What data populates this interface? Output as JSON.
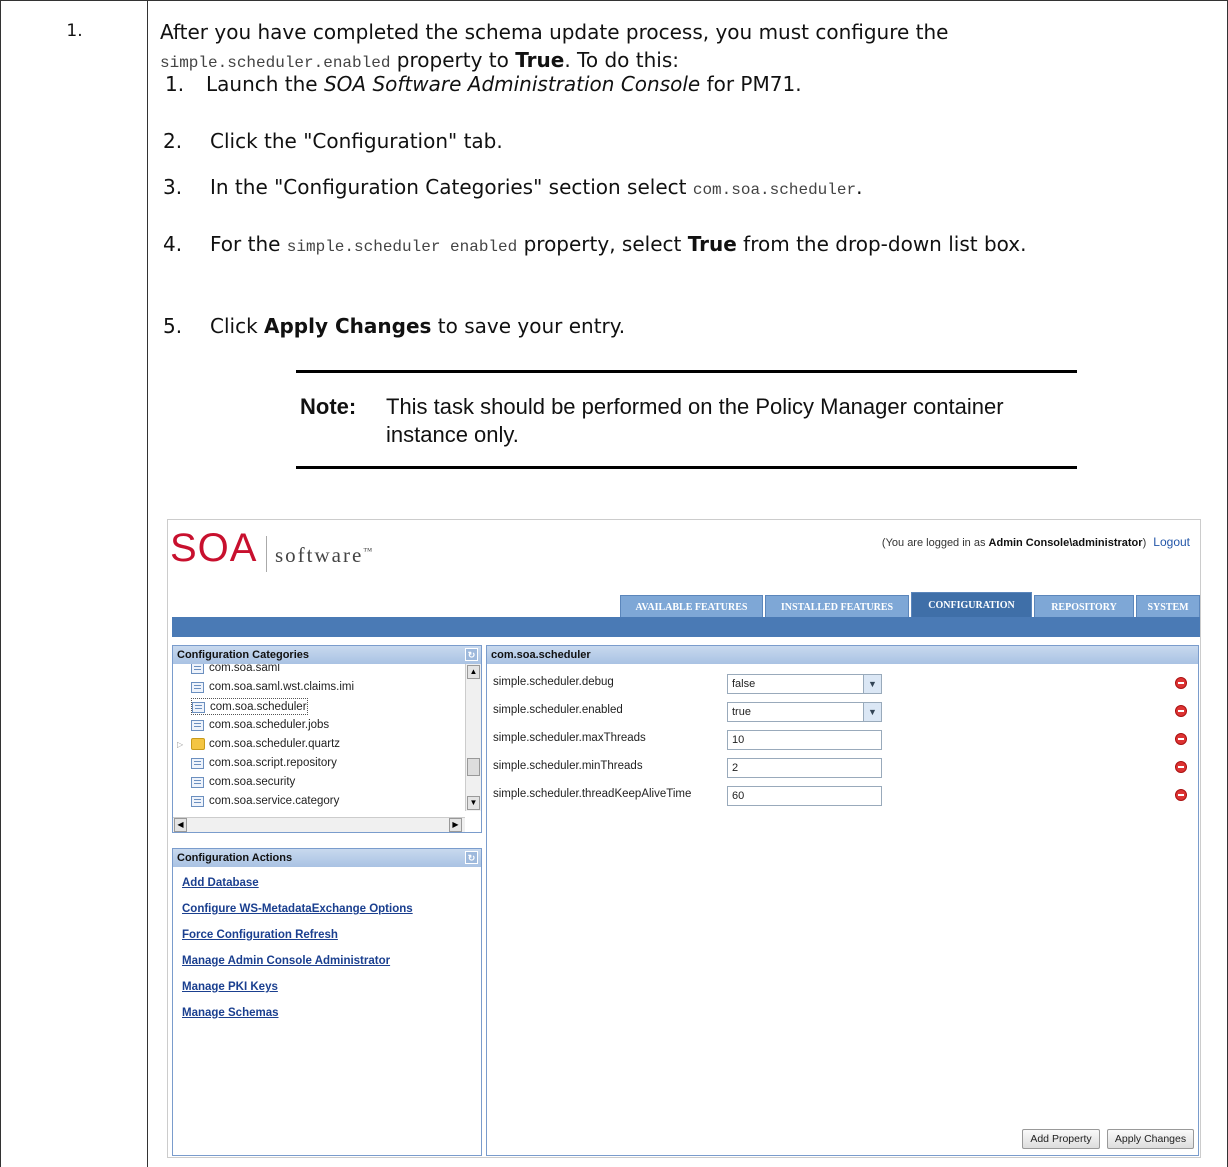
{
  "step_number": "1.",
  "intro": {
    "before": "After you have completed the schema update process, you must configure the",
    "code": "simple.scheduler.enabled",
    "mid": " property to ",
    "bold": "True",
    "after": ". To do this:"
  },
  "steps": [
    {
      "n": "1.",
      "parts": [
        {
          "t": "Launch the "
        },
        {
          "t": "SOA Software Administration Console",
          "i": true
        },
        {
          "t": " for PM71."
        }
      ]
    },
    {
      "n": "2.",
      "parts": [
        {
          "t": "Click the \"Configuration\" tab."
        }
      ]
    },
    {
      "n": "3.",
      "parts": [
        {
          "t": "In the \"Configuration Categories\" section select "
        },
        {
          "t": "com.soa.scheduler",
          "c": true
        },
        {
          "t": "."
        }
      ]
    },
    {
      "n": "4.",
      "parts": [
        {
          "t": "For the "
        },
        {
          "t": "simple.scheduler enabled",
          "c": true
        },
        {
          "t": " property, select "
        },
        {
          "t": "True",
          "b": true
        },
        {
          "t": " from the drop-down list box."
        }
      ]
    },
    {
      "n": "5.",
      "parts": [
        {
          "t": "Click "
        },
        {
          "t": "Apply Changes",
          "b": true
        },
        {
          "t": " to save your entry."
        }
      ]
    }
  ],
  "note": {
    "label": "Note:",
    "text": "This task should be performed on the Policy Manager container instance only."
  },
  "screenshot": {
    "logo_soa": "SOA",
    "logo_software": "software",
    "logo_tm": "™",
    "login_prefix": "(You are logged in as ",
    "login_user": "Admin Console\\administrator",
    "login_suffix": ")",
    "logout": "Logout",
    "tabs": [
      "AVAILABLE FEATURES",
      "INSTALLED FEATURES",
      "CONFIGURATION",
      "REPOSITORY",
      "SYSTEM"
    ],
    "active_tab": "CONFIGURATION",
    "categories_title": "Configuration Categories",
    "categories": [
      {
        "label": "com.soa.saml",
        "type": "item"
      },
      {
        "label": "com.soa.saml.wst.claims.imi",
        "type": "item"
      },
      {
        "label": "com.soa.scheduler",
        "type": "item",
        "selected": true
      },
      {
        "label": "com.soa.scheduler.jobs",
        "type": "item"
      },
      {
        "label": "com.soa.scheduler.quartz",
        "type": "folder"
      },
      {
        "label": "com.soa.script.repository",
        "type": "item"
      },
      {
        "label": "com.soa.security",
        "type": "item"
      },
      {
        "label": "com.soa.service.category",
        "type": "item"
      }
    ],
    "actions_title": "Configuration Actions",
    "actions": [
      "Add Database",
      "Configure WS-MetadataExchange Options",
      "Force Configuration Refresh",
      "Manage Admin Console Administrator",
      "Manage PKI Keys",
      "Manage Schemas"
    ],
    "props_title": "com.soa.scheduler",
    "properties": [
      {
        "name": "simple.scheduler.debug",
        "value": "false",
        "select": true
      },
      {
        "name": "simple.scheduler.enabled",
        "value": "true",
        "select": true
      },
      {
        "name": "simple.scheduler.maxThreads",
        "value": "10",
        "select": false
      },
      {
        "name": "simple.scheduler.minThreads",
        "value": "2",
        "select": false
      },
      {
        "name": "simple.scheduler.threadKeepAliveTime",
        "value": "60",
        "select": false
      }
    ],
    "add_property": "Add Property",
    "apply_changes": "Apply Changes"
  }
}
